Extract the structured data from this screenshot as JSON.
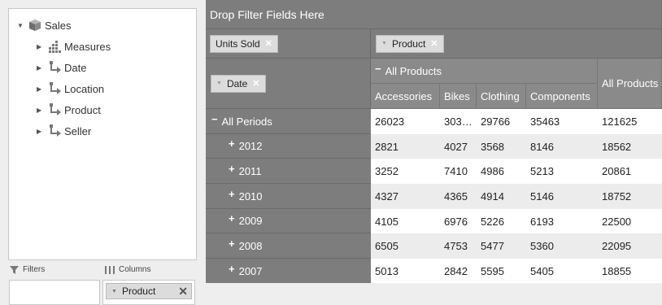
{
  "field_list": {
    "root": {
      "label": "Sales",
      "icon": "cube-icon"
    },
    "items": [
      {
        "label": "Measures",
        "icon": "measures-icon"
      },
      {
        "label": "Date",
        "icon": "hierarchy-icon"
      },
      {
        "label": "Location",
        "icon": "hierarchy-icon"
      },
      {
        "label": "Product",
        "icon": "hierarchy-icon"
      },
      {
        "label": "Seller",
        "icon": "hierarchy-icon"
      }
    ]
  },
  "zones": {
    "filters_label": "Filters",
    "columns_label": "Columns",
    "columns_chip": "Product"
  },
  "pivot": {
    "drop_filter_text": "Drop Filter Fields Here",
    "measure_chip": "Units Sold",
    "column_chip": "Product",
    "row_chip": "Date",
    "all_products_group": "All Products",
    "column_headers": [
      "Accessories",
      "Bikes",
      "Clothing",
      "Components",
      "All Products"
    ],
    "rows": [
      {
        "label": "All Periods",
        "toggle": "−",
        "values": [
          "26023",
          "303…",
          "29766",
          "35463",
          "121625"
        ]
      },
      {
        "label": "2012",
        "toggle": "+",
        "values": [
          "2821",
          "4027",
          "3568",
          "8146",
          "18562"
        ]
      },
      {
        "label": "2011",
        "toggle": "+",
        "values": [
          "3252",
          "7410",
          "4986",
          "5213",
          "20861"
        ]
      },
      {
        "label": "2010",
        "toggle": "+",
        "values": [
          "4327",
          "4365",
          "4914",
          "5146",
          "18752"
        ]
      },
      {
        "label": "2009",
        "toggle": "+",
        "values": [
          "4105",
          "6976",
          "5226",
          "6193",
          "22500"
        ]
      },
      {
        "label": "2008",
        "toggle": "+",
        "values": [
          "6505",
          "4753",
          "5477",
          "5360",
          "22095"
        ]
      },
      {
        "label": "2007",
        "toggle": "+",
        "values": [
          "5013",
          "2842",
          "5595",
          "5405",
          "18855"
        ]
      }
    ]
  }
}
